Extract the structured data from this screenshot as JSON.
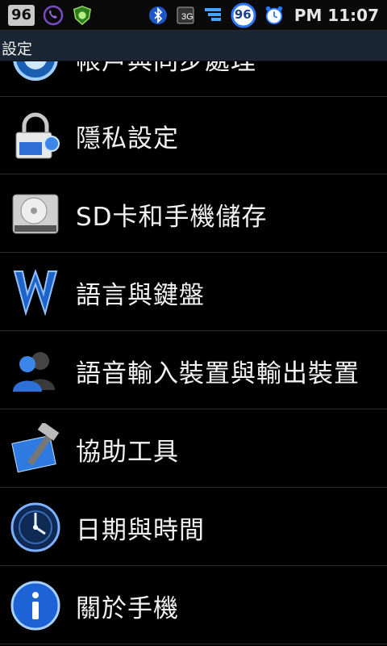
{
  "status_bar": {
    "battery_left": "96",
    "battery_right": "96",
    "time": "PM 11:07",
    "icons": [
      "viber-icon",
      "shield-bug-icon",
      "bluetooth-icon",
      "sync-3g-icon",
      "signal-icon",
      "battery-circle-icon",
      "alarm-icon"
    ]
  },
  "title": "設定",
  "items": [
    {
      "label": "帳戶與同步處理",
      "icon": "sync-globe-icon"
    },
    {
      "label": "隱私設定",
      "icon": "lock-icon"
    },
    {
      "label": "SD卡和手機儲存",
      "icon": "hard-drive-icon"
    },
    {
      "label": "語言與鍵盤",
      "icon": "letter-w-icon"
    },
    {
      "label": "語音輸入裝置與輸出裝置",
      "icon": "users-icon"
    },
    {
      "label": "協助工具",
      "icon": "tools-hammer-icon"
    },
    {
      "label": "日期與時間",
      "icon": "clock-icon"
    },
    {
      "label": "關於手機",
      "icon": "info-icon"
    }
  ],
  "colors": {
    "background": "#000000",
    "title_bar": "#1b2634",
    "divider": "#2c2c2c"
  }
}
